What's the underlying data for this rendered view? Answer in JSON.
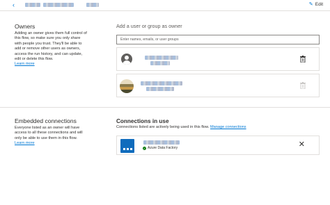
{
  "header": {
    "back_glyph": "‹",
    "edit_label": "Edit",
    "edit_icon": "pencil-icon"
  },
  "owners": {
    "title": "Owners",
    "description": "Adding an owner gives them full control of this flow, so make sure you only share with people you trust. They'll be able to add or remove other users as owners, access the run history, and can update, edit or delete this flow.",
    "learn_more": "Learn more",
    "add_label": "Add a user or group as owner",
    "input_placeholder": "Enter names, emails, or user groups",
    "list": [
      {
        "avatar": "default-user-avatar",
        "delete_icon": "trash-icon",
        "delete_enabled": true
      },
      {
        "avatar": "photo-avatar",
        "delete_icon": "trash-icon",
        "delete_enabled": false
      }
    ]
  },
  "embedded": {
    "title": "Embedded connections",
    "description": "Everyone listed as an owner will have access to all these connections and will only be able to use them in this flow.",
    "learn_more": "Learn more"
  },
  "connections": {
    "title": "Connections in use",
    "subtitle": "Connections listed are actively being used in this flow.",
    "manage_link": "Manage connections",
    "items": [
      {
        "icon": "azure-data-factory-icon",
        "service": "Azure Data Factory",
        "status": "connected",
        "remove_icon": "close-icon"
      }
    ]
  },
  "colors": {
    "accent": "#0078d4",
    "success": "#107c10",
    "connector": "#0f6cbd"
  }
}
